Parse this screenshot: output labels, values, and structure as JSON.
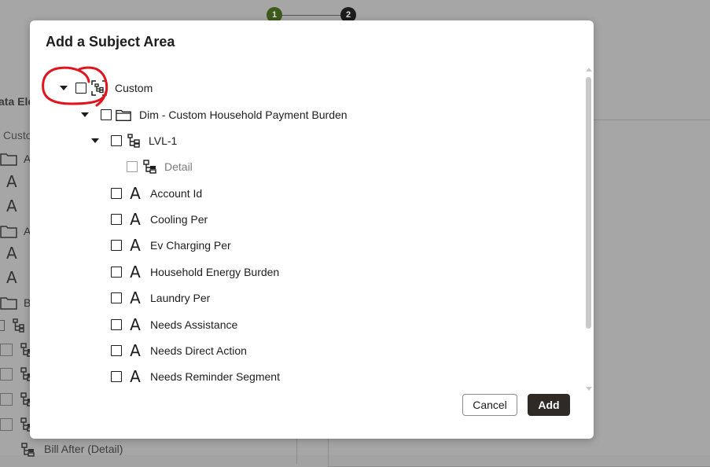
{
  "background": {
    "stepper": {
      "step1": "1",
      "step2": "2",
      "step1_color": "#3d5a1d",
      "step2_color": "#1c1c1c"
    },
    "left_panel": {
      "title_fragment": "ata Ele",
      "subtitle_fragment": "Custo",
      "row_fragments": [
        "A",
        "A",
        "A",
        "A",
        "A",
        "A",
        "B"
      ],
      "bottom_item_label": "Bill After (Detail)"
    },
    "overlay_color": "#a6a6a6"
  },
  "dialog": {
    "title": "Add a Subject Area",
    "tree": [
      {
        "label": "Custom",
        "icon": "subject-area-icon",
        "level": 0,
        "expanded": true
      },
      {
        "label": "Dim - Custom Household Payment Burden",
        "icon": "folder-icon",
        "level": 1,
        "expanded": true
      },
      {
        "label": "LVL-1",
        "icon": "hierarchy-icon",
        "level": 2,
        "expanded": true
      },
      {
        "label": "Detail",
        "icon": "hierarchy-level-icon",
        "level": 3,
        "disabled": true
      },
      {
        "label": "Account Id",
        "icon": "attribute-icon",
        "level": 2
      },
      {
        "label": "Cooling Per",
        "icon": "attribute-icon",
        "level": 2
      },
      {
        "label": "Ev Charging Per",
        "icon": "attribute-icon",
        "level": 2
      },
      {
        "label": "Household Energy Burden",
        "icon": "attribute-icon",
        "level": 2
      },
      {
        "label": "Laundry Per",
        "icon": "attribute-icon",
        "level": 2
      },
      {
        "label": "Needs Assistance",
        "icon": "attribute-icon",
        "level": 2
      },
      {
        "label": "Needs Direct Action",
        "icon": "attribute-icon",
        "level": 2
      },
      {
        "label": "Needs Reminder Segment",
        "icon": "attribute-icon",
        "level": 2
      }
    ],
    "attribute_glyph": "A",
    "buttons": {
      "cancel": "Cancel",
      "add": "Add"
    },
    "annotation_color": "#e0141c",
    "primary_button_color": "#2f2a26"
  }
}
